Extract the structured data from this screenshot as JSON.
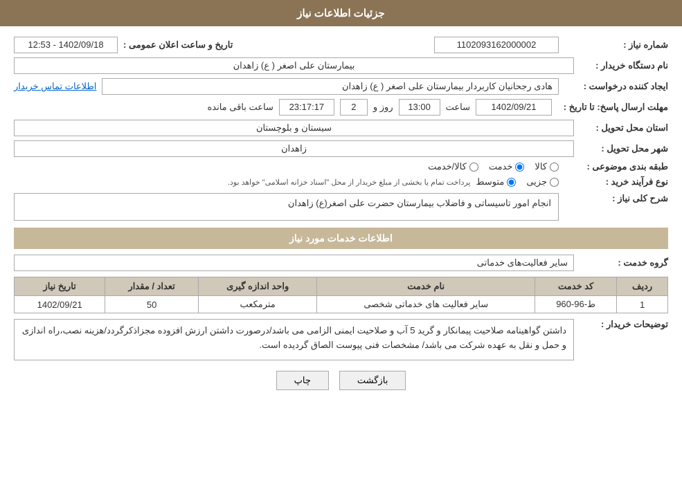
{
  "header": {
    "title": "جزئیات اطلاعات نیاز"
  },
  "fields": {
    "shomareNiaz_label": "شماره نیاز :",
    "shomareNiaz_value": "1102093162000002",
    "namDastgah_label": "نام دستگاه خریدار :",
    "namDastgah_value": "بیمارستان علی اصغر ( ع) زاهدان",
    "ijadKonande_label": "ایجاد کننده درخواست :",
    "ijadKonande_value": "هادی رجحانیان کاربردار بیمارستان علی اصغر ( ع) زاهدان",
    "ettelaat_link": "اطلاعات تماس خریدار",
    "mohlat_label": "مهلت ارسال پاسخ: تا تاریخ :",
    "mohlat_date": "1402/09/21",
    "mohlat_saat": "13:00",
    "mohlat_roz": "2",
    "mohlat_baqi": "23:17:17",
    "ostan_label": "استان محل تحویل :",
    "ostan_value": "سیستان و بلوچستان",
    "shahr_label": "شهر محل تحویل :",
    "shahr_value": "زاهدان",
    "tabaqe_label": "طبقه بندی موضوعی :",
    "tabaqe_kala": "کالا",
    "tabaqe_khadamat": "خدمت",
    "tabaqe_kala_khadamat": "کالا/خدمت",
    "tabaqe_selected": "khadamat",
    "noeFarayand_label": "نوع فرآیند خرید :",
    "noeFarayand_jazei": "جزیی",
    "noeFarayand_motavaset": "متوسط",
    "noeFarayand_note": "پرداخت تمام یا بخشی از مبلغ خریدار از محل \"اسناد خزانه اسلامی\" خواهد بود.",
    "noeFarayand_selected": "motavaset",
    "sharh_label": "شرح کلی نیاز :",
    "sharh_value": "انجام امور تاسیساتی و فاضلاب بیمارستان حضرت علی اصغر(ع) زاهدان",
    "khadamat_section": "اطلاعات خدمات مورد نیاز",
    "grohe_label": "گروه خدمت :",
    "grohe_value": "سایر فعالیت‌های خدماتی",
    "table": {
      "headers": [
        "ردیف",
        "کد خدمت",
        "نام خدمت",
        "واحد اندازه گیری",
        "تعداد / مقدار",
        "تاریخ نیاز"
      ],
      "rows": [
        {
          "radif": "1",
          "kodKhadamat": "ط-96-960",
          "namKhadamat": "سایر فعالیت های خدماتی شخصی",
          "vahed": "مترمکعب",
          "tedad": "50",
          "tarikh": "1402/09/21"
        }
      ]
    },
    "tosihKharidar_label": "توضیحات خریدار :",
    "tosihKharidar_value": "داشتن گواهینامه صلاحیت پیمانکار و گرید 5 آب و صلاحیت ایمنی الزامی می باشد/درصورت داشتن ارزش افزوده مجزاذکرگردد/هزینه نصب،راه اندازی و حمل و نقل به عهده شرکت می باشد/ مشخصات فنی پیوست الصاق گردیده است.",
    "buttons": {
      "chap": "چاپ",
      "bazgasht": "بازگشت"
    },
    "saat_label": "ساعت",
    "roz_label": "روز و",
    "baqi_label": "ساعت باقی مانده",
    "tarikh_label": "تاریخ و ساعت اعلان عمومی :",
    "tarikh_ealaan": "1402/09/18 - 12:53"
  }
}
